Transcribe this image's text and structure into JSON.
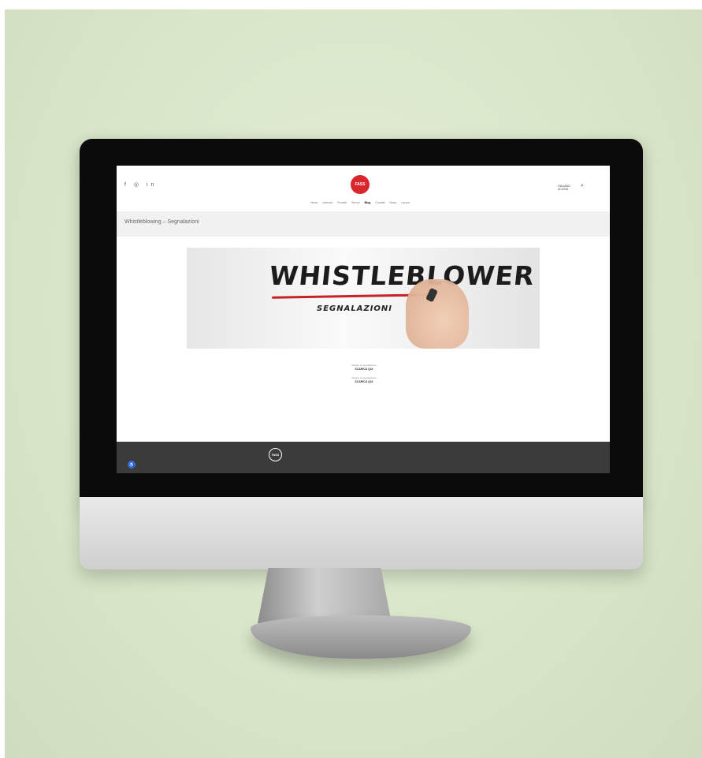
{
  "colors": {
    "brand": "#d9262c",
    "footer": "#3b3b3b",
    "accent_blue": "#3a6ed8",
    "background": "#d9e6c9"
  },
  "header": {
    "social_icons": [
      "facebook-icon",
      "instagram-icon",
      "linkedin-icon"
    ],
    "social_text": "f ◎ in",
    "logo_text": "FASS",
    "nav": [
      "Home",
      "Azienda",
      "Prodotti",
      "Servizi",
      "Blog",
      "Contatti",
      "News",
      "Lavora"
    ],
    "active_nav_index": 4,
    "account_line1": "ITALIANO",
    "account_line2": "ACCEDI"
  },
  "page": {
    "title": "Whistleblowing – Segnalazioni",
    "banner_title": "WHISTLEBLOWER",
    "banner_subtitle": "SEGNALAZIONI",
    "body_text": "",
    "link1_label": "Modulo di segnalazione",
    "link1_button": "SCARICA QUI",
    "link2_label": "Modulo di segnalazione",
    "link2_button": "SCARICA QUI"
  },
  "footer": {
    "logo_text": "FASS",
    "links": "",
    "info": ""
  }
}
